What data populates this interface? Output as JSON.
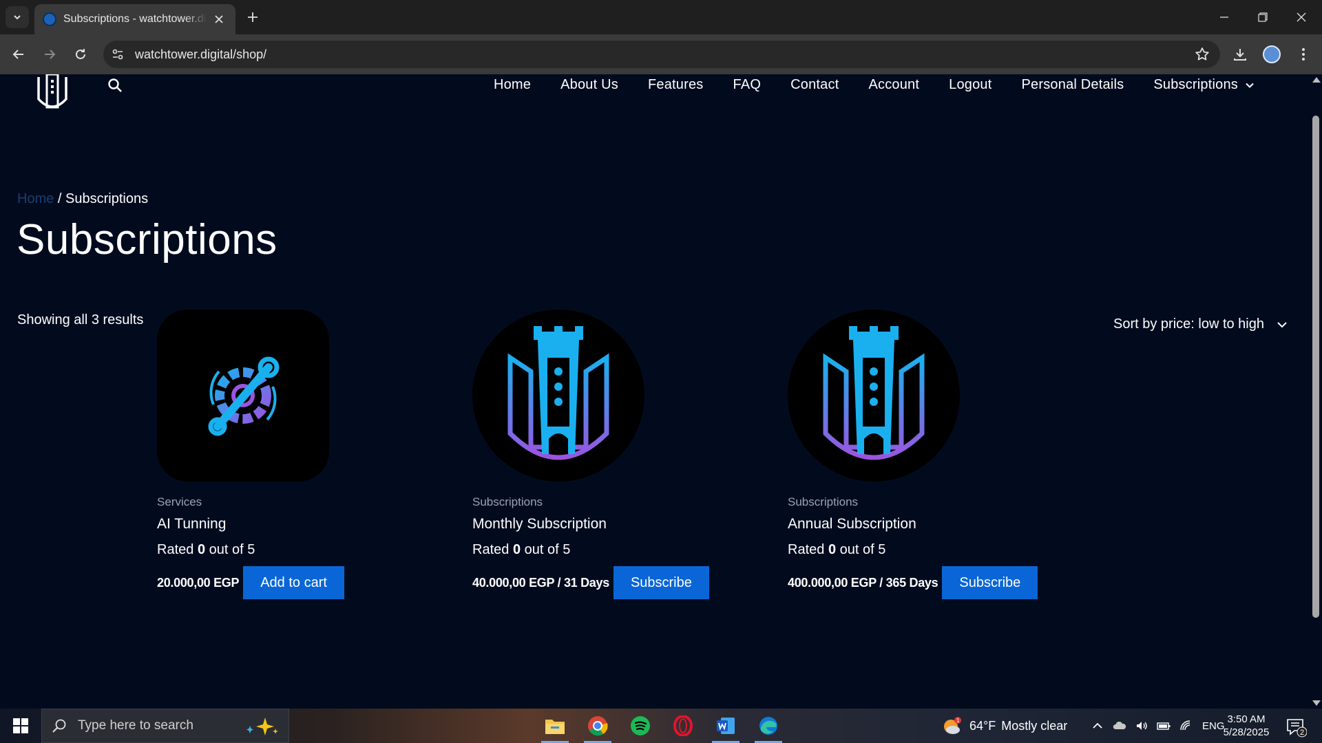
{
  "browser": {
    "tab_title": "Subscriptions - watchtower.digital",
    "url": "watchtower.digital/shop/"
  },
  "nav": {
    "items": [
      "Home",
      "About Us",
      "Features",
      "FAQ",
      "Contact",
      "Account",
      "Logout",
      "Personal Details",
      "Subscriptions"
    ]
  },
  "breadcrumb": {
    "home": "Home",
    "separator": " / ",
    "current": "Subscriptions"
  },
  "page_title": "Subscriptions",
  "results": {
    "count_text": "Showing all 3 results",
    "sort_label": "Sort by price: low to high"
  },
  "products": [
    {
      "category": "Services",
      "name": "AI Tunning",
      "rating_prefix": "Rated ",
      "rating_value": "0",
      "rating_suffix": " out of 5",
      "price": "20.000,00 EGP",
      "button": "Add to cart"
    },
    {
      "category": "Subscriptions",
      "name": "Monthly Subscription",
      "rating_prefix": "Rated ",
      "rating_value": "0",
      "rating_suffix": " out of 5",
      "price": "40.000,00 EGP / 31 Days",
      "button": "Subscribe"
    },
    {
      "category": "Subscriptions",
      "name": "Annual Subscription",
      "rating_prefix": "Rated ",
      "rating_value": "0",
      "rating_suffix": " out of 5",
      "price": "400.000,00 EGP / 365 Days",
      "button": "Subscribe"
    }
  ],
  "taskbar": {
    "search_placeholder": "Type here to search",
    "weather_temp": "64°F",
    "weather_text": "Mostly clear",
    "weather_badge": "1",
    "language": "ENG",
    "time": "3:50 AM",
    "date": "5/28/2025",
    "notification_count": "2"
  },
  "colors": {
    "page_bg": "#020b1e",
    "button_blue": "#0a66d6",
    "icon_cyan": "#1ab0ef",
    "icon_purple": "#9b54e0"
  }
}
